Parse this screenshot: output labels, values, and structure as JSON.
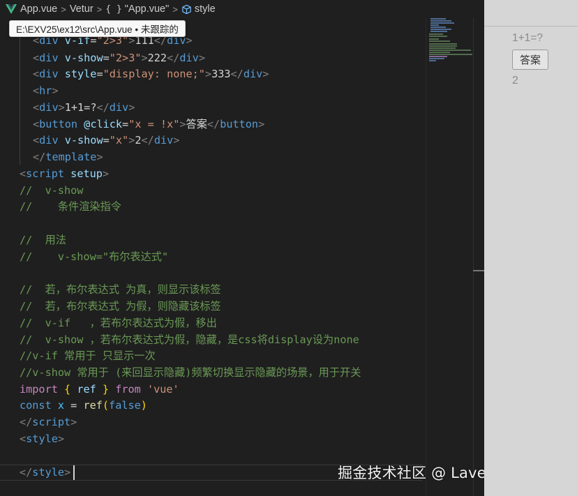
{
  "breadcrumb": {
    "file": "App.vue",
    "vetur": "Vetur",
    "braces": "{ }",
    "component": "\"App.vue\"",
    "section": "style",
    "separator": ">"
  },
  "tooltip": {
    "path": "E:\\EXV25\\ex12\\src\\App.vue • 未跟踪的"
  },
  "code": {
    "l1": [
      "<",
      "div",
      " v-if",
      "=",
      "\"2>3\"",
      ">",
      "111",
      "</",
      "div",
      ">"
    ],
    "l2": [
      "<",
      "div",
      " v-show",
      "=",
      "\"2>3\"",
      ">",
      "222",
      "</",
      "div",
      ">"
    ],
    "l3": [
      "<",
      "div",
      " style",
      "=",
      "\"display: ",
      "none",
      ";\"",
      ">",
      "333",
      "</",
      "div",
      ">"
    ],
    "l4": [
      "<",
      "hr",
      ">"
    ],
    "l5": [
      "<",
      "div",
      ">",
      "1+1=?",
      "</",
      "div",
      ">"
    ],
    "l6": [
      "<",
      "button",
      " @click",
      "=",
      "\"x = !x\"",
      ">",
      "答案",
      "</",
      "button",
      ">"
    ],
    "l7": [
      "<",
      "div",
      " v-show",
      "=",
      "\"x\"",
      ">",
      "2",
      "</",
      "div",
      ">"
    ],
    "l8": [
      "</",
      "template",
      ">"
    ],
    "l9": [
      "<",
      "script",
      " setup",
      ">"
    ],
    "c1": "//  v-show",
    "c2": "//    条件渲染指令",
    "c3": "//  用法",
    "c4": "//    v-show=\"布尔表达式\"",
    "c5": "//  若，布尔表达式 为真，则显示该标签",
    "c6": "//  若，布尔表达式 为假，则隐藏该标签",
    "c7": "//  v-if   ，若布尔表达式为假，移出",
    "c8": "//  v-show ，若布尔表达式为假，隐藏，是css将display设为none",
    "c9": "//v-if 常用于 只显示一次",
    "c10": "//v-show 常用于 (来回显示隐藏)频繁切换显示隐藏的场景，用于开关",
    "imp": [
      "import",
      " ",
      "{",
      " ref ",
      "}",
      " from ",
      "'vue'"
    ],
    "cst": [
      "const",
      " x",
      " = ",
      "ref",
      "(",
      "false",
      ")"
    ],
    "l10": [
      "</",
      "script",
      ">"
    ],
    "l11": [
      "<",
      "style",
      ">"
    ],
    "l12": [
      "</",
      "style",
      ">"
    ]
  },
  "watermark": "掘金技术社区 @ LavenderSY",
  "preview": {
    "question": "1+1=?",
    "button_label": "答案",
    "answer": "2"
  }
}
